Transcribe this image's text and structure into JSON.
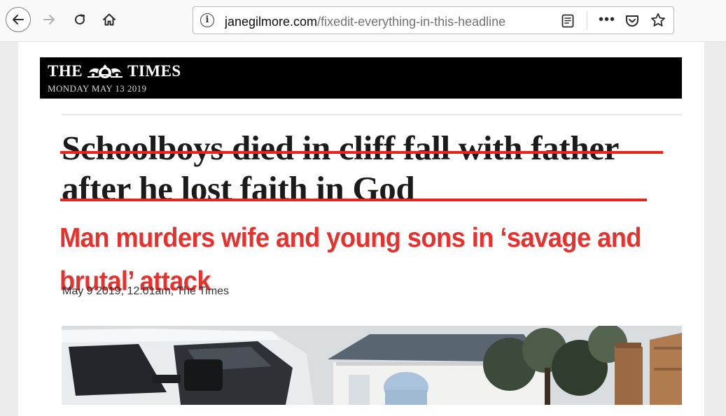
{
  "browser": {
    "url_host": "janegilmore.com",
    "url_path": "/fixedit-everything-in-this-headline"
  },
  "masthead": {
    "title_left": "THE",
    "title_right": "TIMES",
    "date": "MONDAY MAY 13 2019"
  },
  "article": {
    "original_headline": "Schoolboys died in cliff fall with father after he lost faith in God",
    "corrected_headline": "Man murders wife and young sons in ‘savage and brutal’ attack",
    "byline": "May 9 2019, 12:01am, The Times"
  },
  "colors": {
    "strike": "#e8241f",
    "corrected_headline": "#e8302c",
    "masthead_bg": "#000000"
  },
  "icons": [
    "back-arrow-icon",
    "forward-arrow-icon",
    "reload-icon",
    "home-icon",
    "info-icon",
    "reader-view-icon",
    "more-icon",
    "pocket-icon",
    "star-icon",
    "crest-icon"
  ]
}
